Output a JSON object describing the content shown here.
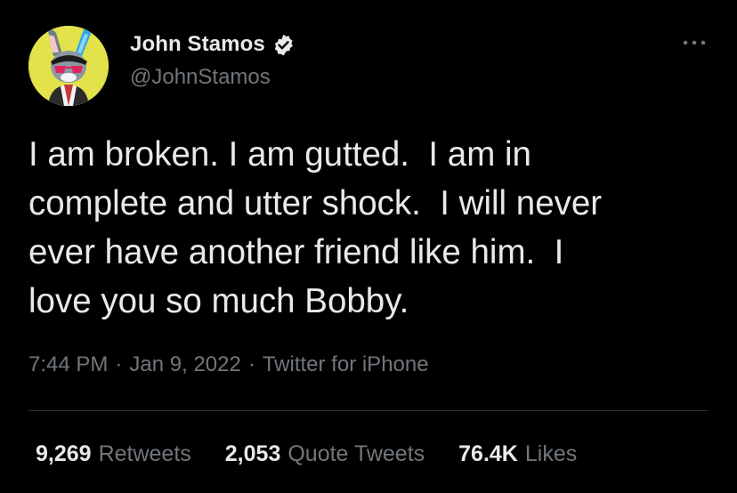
{
  "author": {
    "display_name": "John Stamos",
    "handle": "@JohnStamos",
    "verified": true,
    "avatar_icon": "cartoon-rabbit-avatar",
    "verified_icon": "verified-badge-icon"
  },
  "tweet": {
    "text": "I am broken. I am gutted.  I am in\ncomplete and utter shock.  I will never\never have another friend like him.  I\nlove you so much Bobby."
  },
  "meta": {
    "time": "7:44 PM",
    "separator": "·",
    "date": "Jan 9, 2022",
    "source": "Twitter for iPhone"
  },
  "stats": [
    {
      "count": "9,269",
      "label": "Retweets"
    },
    {
      "count": "2,053",
      "label": "Quote Tweets"
    },
    {
      "count": "76.4K",
      "label": "Likes"
    }
  ],
  "colors": {
    "background": "#000000",
    "primary_text": "#e7e9ea",
    "secondary_text": "#71767b",
    "divider": "#2f3336",
    "avatar_bg": "#e2e24a"
  }
}
